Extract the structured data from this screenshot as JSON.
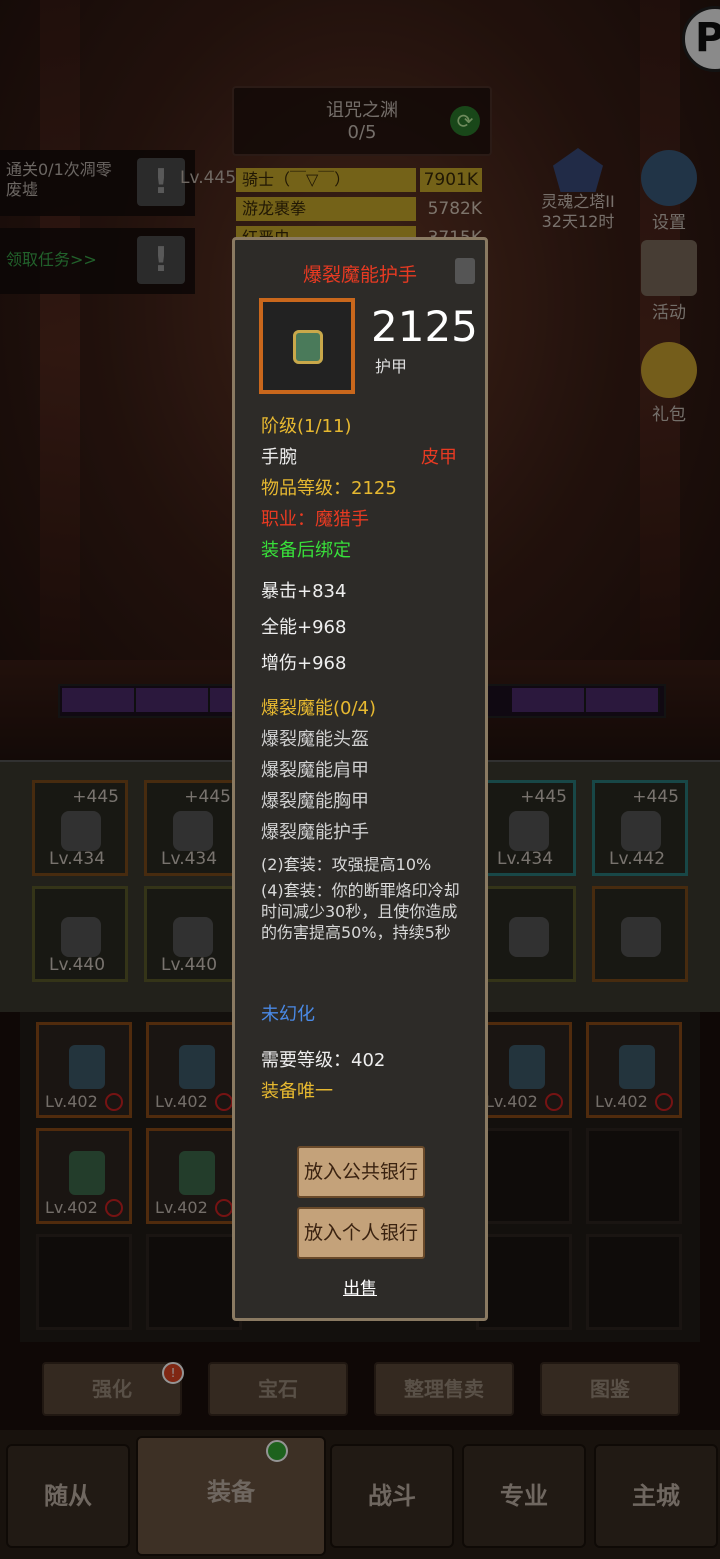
{
  "hud": {
    "dungeon_name": "诅咒之渊",
    "dungeon_progress": "0/5",
    "quest1": "通关0/1次凋零废墟",
    "quest2": "领取任务>>",
    "player_level": "Lv.445",
    "rank_rows": [
      {
        "name": "骑士（￣▽￣）",
        "value": "7901K"
      },
      {
        "name": "游龙裹拳",
        "value": "5782K"
      },
      {
        "name": "红严虫",
        "value": "3715K"
      }
    ],
    "tower_name": "灵魂之塔II",
    "tower_time": "32天12时",
    "settings_label": "设置",
    "activity_label": "活动",
    "gift_label": "礼包",
    "team_levels": [
      "445",
      "445",
      "445"
    ]
  },
  "equipped": [
    {
      "plus": "+445",
      "level": "Lv.434"
    },
    {
      "plus": "+445",
      "level": "Lv.434"
    },
    {
      "plus": "+445",
      "level": "Lv.434"
    },
    {
      "plus": "+445",
      "level": "Lv.442"
    },
    {
      "level": "Lv.440"
    },
    {
      "level": "Lv.440"
    }
  ],
  "bag_levels": [
    "Lv.402",
    "Lv.402",
    "Lv.402",
    "Lv.402",
    "Lv.402",
    "Lv.402"
  ],
  "functions": {
    "enhance": "强化",
    "gem": "宝石",
    "sort_sell": "整理售卖",
    "codex": "图鉴",
    "enhance_badge": "!"
  },
  "nav": {
    "follower": "随从",
    "equipment": "装备",
    "battle": "战斗",
    "profession": "专业",
    "main_city": "主城"
  },
  "tooltip": {
    "item_name": "爆裂魔能护手",
    "armor_value": "2125",
    "armor_label": "护甲",
    "tier": "阶级(1/11)",
    "slot": "手腕",
    "material": "皮甲",
    "item_level": "物品等级：2125",
    "class": "职业：魔猎手",
    "binding": "装备后绑定",
    "stats": [
      "暴击+834",
      "全能+968",
      "增伤+968"
    ],
    "set_name": "爆裂魔能(0/4)",
    "set_pieces": [
      "爆裂魔能头盔",
      "爆裂魔能肩甲",
      "爆裂魔能胸甲",
      "爆裂魔能护手"
    ],
    "set_bonus_2": "(2)套装：攻强提高10%",
    "set_bonus_4": "(4)套装：你的断罪烙印冷却时间减少30秒，且使你造成的伤害提高50%，持续5秒",
    "transmog": "未幻化",
    "required_level": "需要等级：402",
    "unique": "装备唯一",
    "btn_public_bank": "放入公共银行",
    "btn_private_bank": "放入个人银行",
    "btn_sell": "出售"
  }
}
